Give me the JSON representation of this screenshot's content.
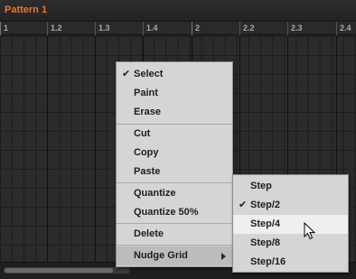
{
  "pattern": {
    "name": "Pattern 1"
  },
  "ruler": {
    "labels": [
      "1",
      "1.2",
      "1.3",
      "1.4",
      "2",
      "2.2",
      "2.3",
      "2.4"
    ]
  },
  "context_menu": {
    "items": [
      {
        "label": "Select",
        "checked": true
      },
      {
        "label": "Paint",
        "checked": false
      },
      {
        "label": "Erase",
        "checked": false
      },
      {
        "label": "Cut",
        "checked": false
      },
      {
        "label": "Copy",
        "checked": false
      },
      {
        "label": "Paste",
        "checked": false
      },
      {
        "label": "Quantize",
        "checked": false
      },
      {
        "label": "Quantize 50%",
        "checked": false
      },
      {
        "label": "Delete",
        "checked": false
      },
      {
        "label": "Nudge Grid",
        "checked": false,
        "submenu": true
      }
    ]
  },
  "submenu": {
    "items": [
      {
        "label": "Step",
        "checked": false
      },
      {
        "label": "Step/2",
        "checked": true
      },
      {
        "label": "Step/4",
        "checked": false
      },
      {
        "label": "Step/8",
        "checked": false
      },
      {
        "label": "Step/16",
        "checked": false
      }
    ]
  },
  "colors": {
    "accent": "#e8743c",
    "menu_bg": "#d5d5d5",
    "grid_bg": "#2b2b2b"
  },
  "check_mark": "✔"
}
